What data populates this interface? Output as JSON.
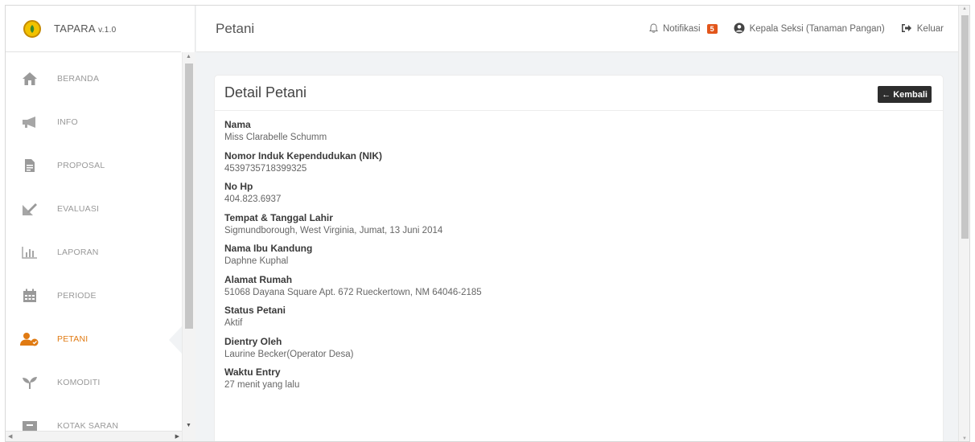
{
  "app": {
    "name": "TAPARA",
    "version": "v.1.0"
  },
  "sidebar": {
    "items": [
      {
        "label": "BERANDA",
        "icon": "home-icon"
      },
      {
        "label": "INFO",
        "icon": "megaphone-icon"
      },
      {
        "label": "PROPOSAL",
        "icon": "document-icon"
      },
      {
        "label": "EVALUASI",
        "icon": "evaluation-icon"
      },
      {
        "label": "LAPORAN",
        "icon": "bar-chart-icon"
      },
      {
        "label": "PERIODE",
        "icon": "calendar-icon"
      },
      {
        "label": "PETANI",
        "icon": "users-icon",
        "active": true
      },
      {
        "label": "KOMODITI",
        "icon": "sprout-icon"
      },
      {
        "label": "KOTAK SARAN",
        "icon": "inbox-icon"
      }
    ]
  },
  "header": {
    "title": "Petani",
    "notifications_label": "Notifikasi",
    "notifications_count": "5",
    "user_label": "Kepala Seksi (Tanaman Pangan)",
    "logout_label": "Keluar"
  },
  "card": {
    "title": "Detail Petani",
    "back_label": "← Kembali",
    "fields": [
      {
        "label": "Nama",
        "value": "Miss Clarabelle Schumm"
      },
      {
        "label": "Nomor Induk Kependudukan (NIK)",
        "value": "4539735718399325"
      },
      {
        "label": "No Hp",
        "value": "404.823.6937"
      },
      {
        "label": "Tempat & Tanggal Lahir",
        "value": "Sigmundborough, West Virginia, Jumat, 13 Juni 2014"
      },
      {
        "label": "Nama Ibu Kandung",
        "value": "Daphne Kuphal"
      },
      {
        "label": "Alamat Rumah",
        "value": "51068 Dayana Square Apt. 672 Rueckertown, NM 64046-2185"
      },
      {
        "label": "Status Petani",
        "value": "Aktif"
      },
      {
        "label": "Dientry Oleh",
        "value": "Laurine Becker(Operator Desa)"
      },
      {
        "label": "Waktu Entry",
        "value": "27 menit yang lalu"
      }
    ]
  },
  "colors": {
    "accent": "#e07a12",
    "badge": "#e2561b",
    "button": "#2d2d2d"
  }
}
